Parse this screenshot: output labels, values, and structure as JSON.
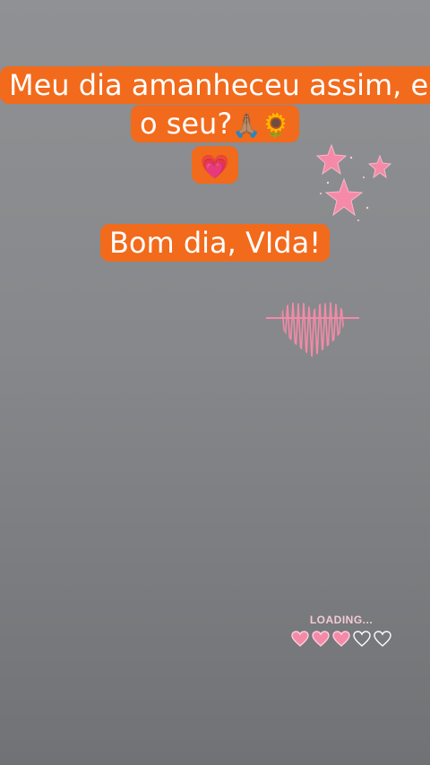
{
  "story": {
    "caption_1": {
      "text": "Meu dia amanheceu assim, e o seu?",
      "emojis": [
        "🙏🏽",
        "🌻",
        "💗"
      ]
    },
    "caption_2": {
      "text": "Bom dia, VIda!"
    },
    "loading_sticker": {
      "label": "LOADING...",
      "filled_hearts": 3,
      "total_hearts": 5
    },
    "colors": {
      "caption_bg": "#f26a1b",
      "caption_text": "#ffffff",
      "sticker_pink": "#f48aa8",
      "background_top": "#8f9194",
      "background_bottom": "#707275"
    },
    "icons": [
      "star-icon",
      "heartbeat-heart-icon",
      "heart-icon"
    ]
  }
}
